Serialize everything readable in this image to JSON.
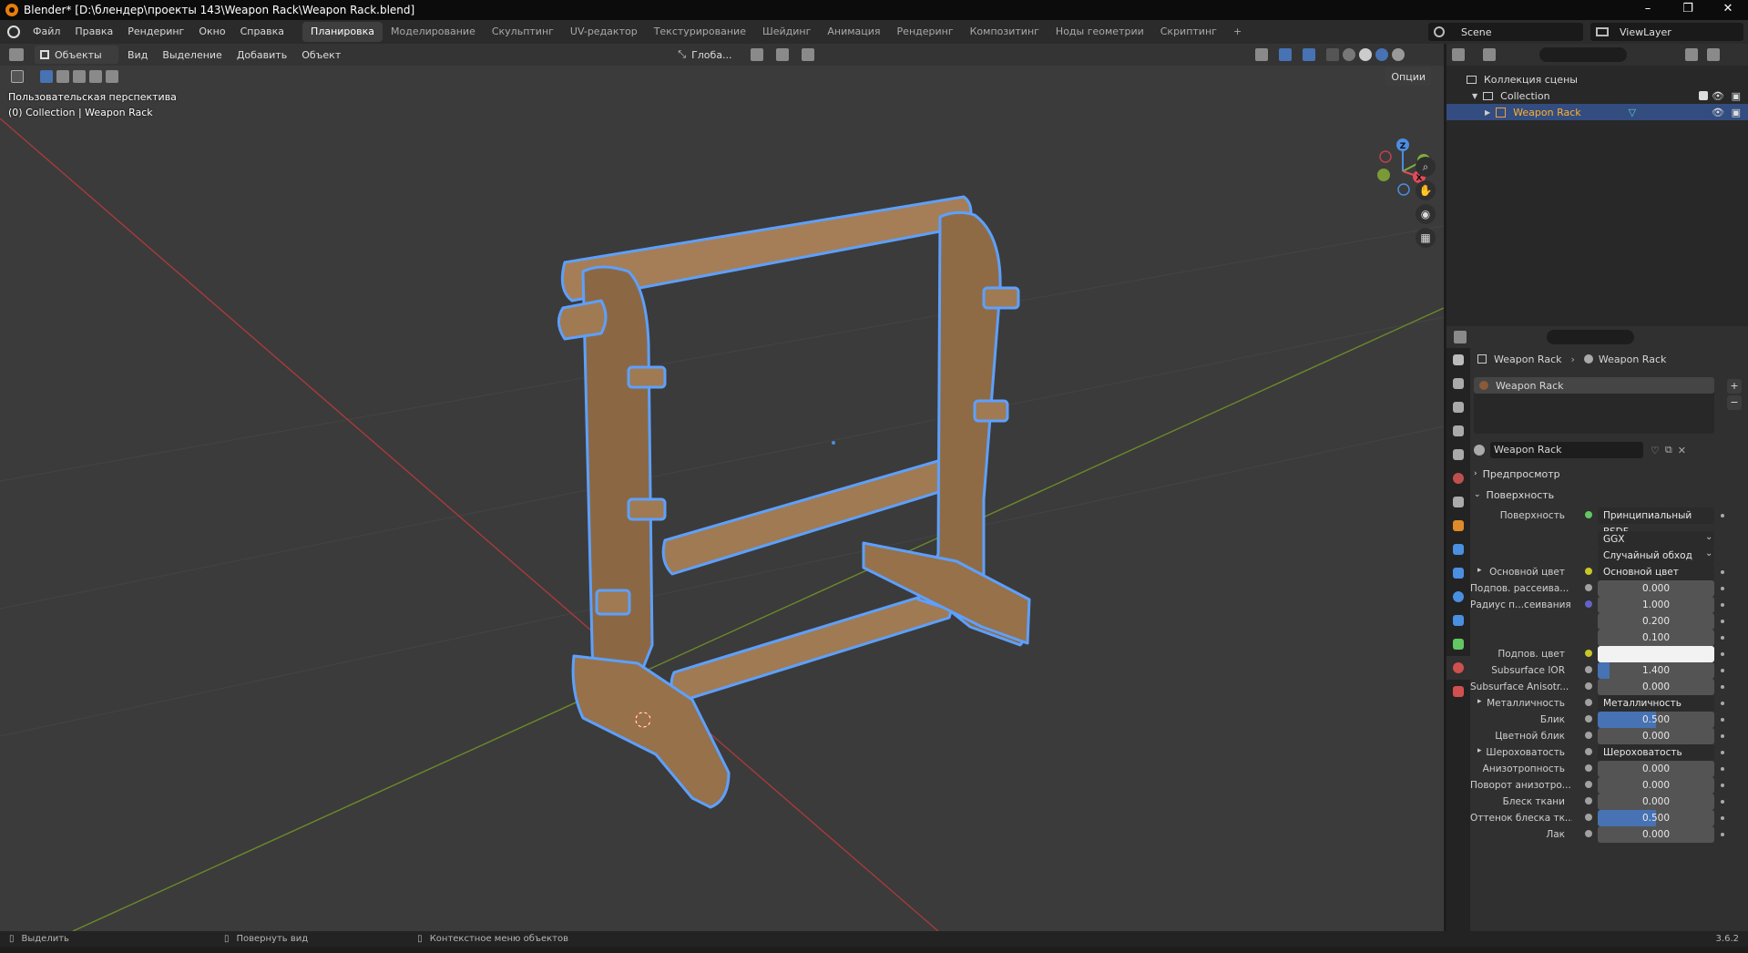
{
  "window": {
    "title": "Blender* [D:\\блендер\\проекты 143\\Weapon Rack\\Weapon Rack.blend]",
    "minimize": "–",
    "maximize": "❐",
    "close": "✕"
  },
  "menu": [
    "Файл",
    "Правка",
    "Рендеринг",
    "Окно",
    "Справка"
  ],
  "workspaces": [
    {
      "label": "Планировка",
      "active": true
    },
    {
      "label": "Моделирование"
    },
    {
      "label": "Скульптинг"
    },
    {
      "label": "UV-редактор"
    },
    {
      "label": "Текстурирование"
    },
    {
      "label": "Шейдинг"
    },
    {
      "label": "Анимация"
    },
    {
      "label": "Рендеринг"
    },
    {
      "label": "Композитинг"
    },
    {
      "label": "Ноды геометрии"
    },
    {
      "label": "Скриптинг"
    }
  ],
  "add_workspace": "+",
  "scene": {
    "name": "Scene",
    "view_layer": "ViewLayer"
  },
  "viewport": {
    "mode": "Объекты",
    "menus": [
      "Вид",
      "Выделение",
      "Добавить",
      "Объект"
    ],
    "orientation": "Глоба...",
    "options": "Опции",
    "view_name": "Пользовательская перспектива",
    "collection_info": "(0) Collection | Weapon Rack",
    "gizmo": {
      "x": "X",
      "y": "Y",
      "z": "Z"
    }
  },
  "outliner": {
    "scene_collection": "Коллекция сцены",
    "collection": "Collection",
    "object": "Weapon Rack"
  },
  "properties": {
    "breadcrumb_obj": "Weapon Rack",
    "breadcrumb_mat": "Weapon Rack",
    "slot": "Weapon Rack",
    "material_name": "Weapon Rack",
    "preview": "Предпросмотр",
    "surface_section": "Поверхность",
    "rows": [
      {
        "label": "Поверхность",
        "value": "Принципиальный BSDF",
        "type": "dark",
        "socket": "#63c763"
      },
      {
        "label": "",
        "value": "GGX",
        "type": "dropdown"
      },
      {
        "label": "",
        "value": "Случайный обход",
        "type": "dropdown"
      },
      {
        "label": "Основной цвет",
        "value": "Основной цвет",
        "type": "dark",
        "socket": "#c7c729",
        "expand": true
      },
      {
        "label": "Подпов. рассеива...",
        "value": "0.000",
        "type": "num",
        "socket": "#a1a1a1"
      },
      {
        "label": "Радиус п...сеивания",
        "value": "1.000",
        "type": "num",
        "socket": "#6363c7"
      },
      {
        "label": "",
        "value": "0.200",
        "type": "num"
      },
      {
        "label": "",
        "value": "0.100",
        "type": "num"
      },
      {
        "label": "Подпов. цвет",
        "value": "",
        "type": "color",
        "socket": "#c7c729"
      },
      {
        "label": "Subsurface IOR",
        "value": "1.400",
        "type": "num",
        "socket": "#a1a1a1",
        "fill": 0.1
      },
      {
        "label": "Subsurface Anisotr...",
        "value": "0.000",
        "type": "num",
        "socket": "#a1a1a1"
      },
      {
        "label": "Металличность",
        "value": "Металличность",
        "type": "dark",
        "socket": "#a1a1a1",
        "expand": true
      },
      {
        "label": "Блик",
        "value": "0.500",
        "type": "num",
        "socket": "#a1a1a1",
        "fill": 0.5
      },
      {
        "label": "Цветной блик",
        "value": "0.000",
        "type": "num",
        "socket": "#a1a1a1"
      },
      {
        "label": "Шероховатость",
        "value": "Шероховатость",
        "type": "dark",
        "socket": "#a1a1a1",
        "expand": true
      },
      {
        "label": "Анизотропность",
        "value": "0.000",
        "type": "num",
        "socket": "#a1a1a1"
      },
      {
        "label": "Поворот анизотро...",
        "value": "0.000",
        "type": "num",
        "socket": "#a1a1a1"
      },
      {
        "label": "Блеск ткани",
        "value": "0.000",
        "type": "num",
        "socket": "#a1a1a1"
      },
      {
        "label": "Оттенок блеска тк...",
        "value": "0.500",
        "type": "num",
        "socket": "#a1a1a1",
        "fill": 0.5
      },
      {
        "label": "Лак",
        "value": "0.000",
        "type": "num",
        "socket": "#a1a1a1"
      }
    ]
  },
  "status": {
    "select": "Выделить",
    "rotate": "Повернуть вид",
    "context": "Контекстное меню объектов",
    "version": "3.6.2"
  }
}
